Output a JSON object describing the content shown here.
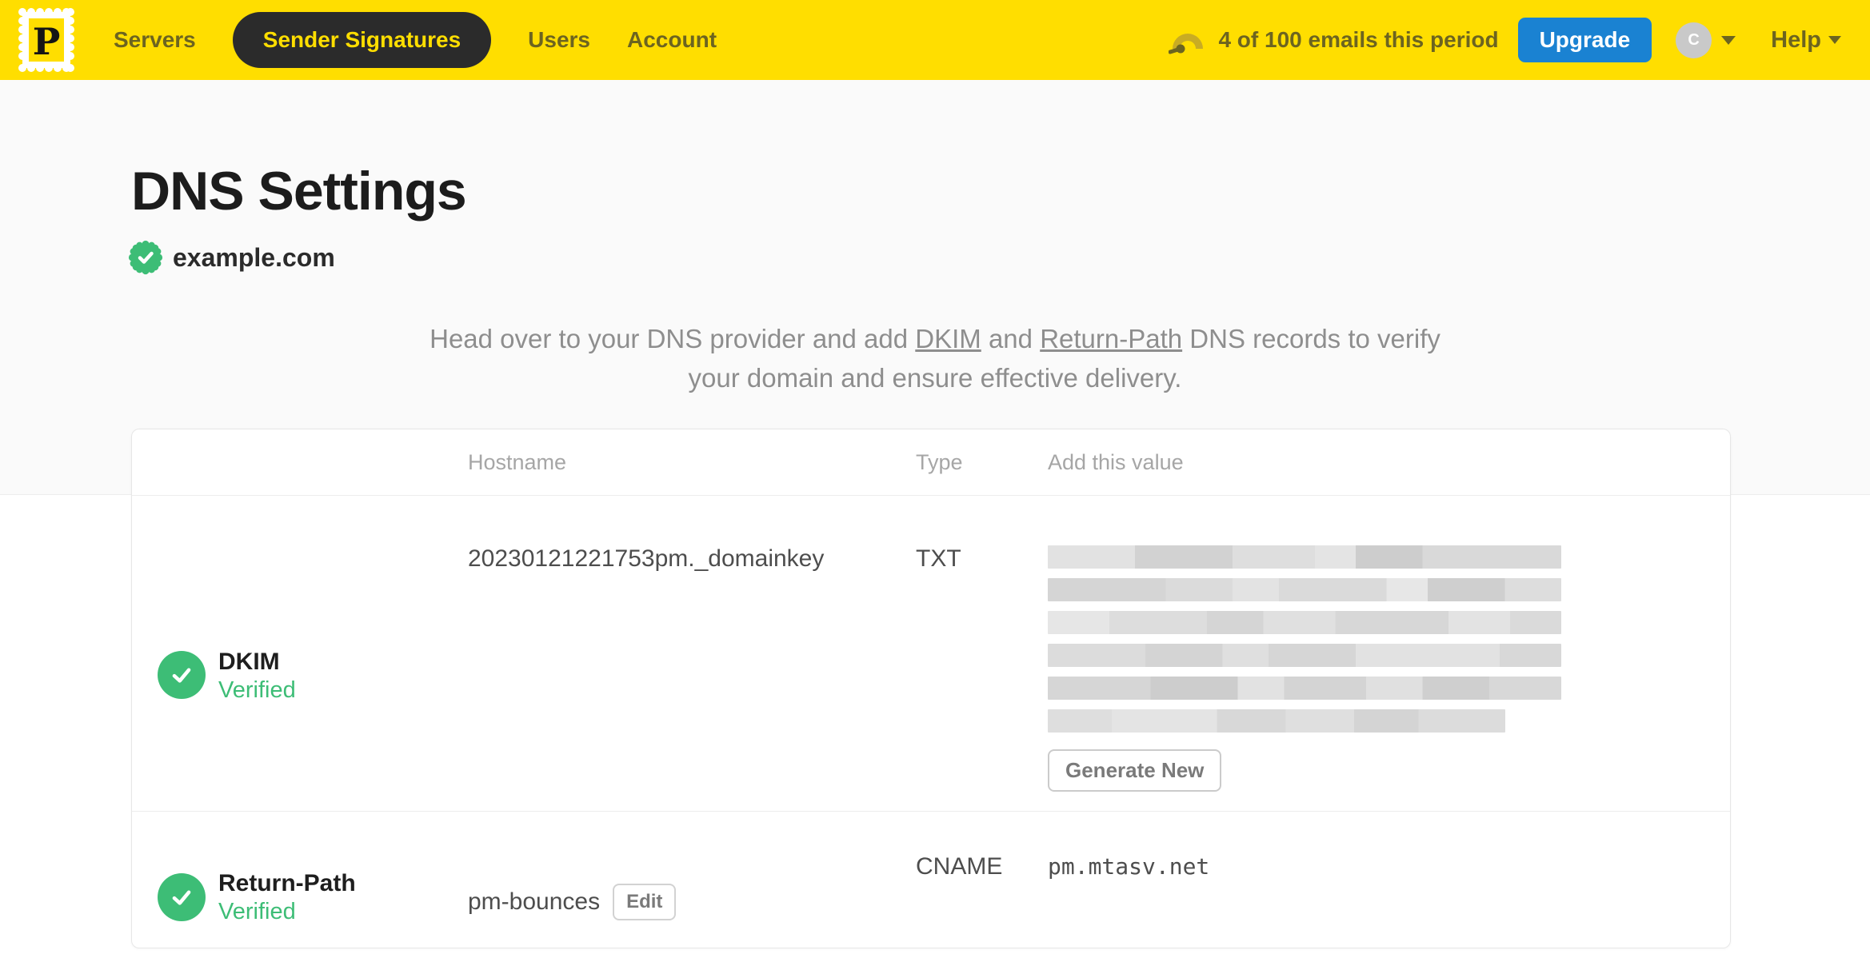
{
  "brand": {
    "logo_letter": "P"
  },
  "navbar": {
    "items": [
      {
        "label": "Servers",
        "active": false
      },
      {
        "label": "Sender Signatures",
        "active": true
      },
      {
        "label": "Users",
        "active": false
      },
      {
        "label": "Account",
        "active": false
      }
    ],
    "usage_text": "4 of 100 emails this period",
    "upgrade_label": "Upgrade",
    "avatar_initial": "C",
    "help_label": "Help"
  },
  "page": {
    "title": "DNS Settings",
    "domain": "example.com",
    "intro": {
      "before": "Head over to your DNS provider and add ",
      "dkim_link": "DKIM",
      "middle": " and ",
      "return_path_link": "Return-Path",
      "after": " DNS records to verify your domain and ensure effective delivery."
    }
  },
  "table": {
    "headers": {
      "hostname": "Hostname",
      "type": "Type",
      "value": "Add this value"
    },
    "rows": [
      {
        "name": "DKIM",
        "status": "Verified",
        "hostname": "20230121221753pm._domainkey",
        "type": "TXT",
        "value_redacted": true,
        "redacted_lines": 6,
        "action_label": "Generate New"
      },
      {
        "name": "Return-Path",
        "status": "Verified",
        "hostname": "pm-bounces",
        "hostname_action": "Edit",
        "type": "CNAME",
        "value": "pm.mtasv.net"
      }
    ]
  },
  "colors": {
    "brand_yellow": "#FFDE00",
    "nav_pill_dark": "#2B2B2B",
    "nav_text_olive": "#6C6420",
    "upgrade_blue": "#1A82D2",
    "verified_green": "#3DBD76",
    "muted_text": "#8E8E8E"
  }
}
